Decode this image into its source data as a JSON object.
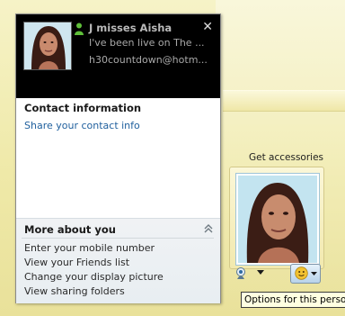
{
  "contact_card": {
    "name": "J misses Aisha",
    "message": "I've been live on The ...",
    "email": "h30countdown@hotm...",
    "status_color": "#5fbf3a",
    "contact_info": {
      "title": "Contact information",
      "share_link": "Share your contact info"
    },
    "more_about": {
      "title": "More about you",
      "items": [
        "Enter your mobile number",
        "View your Friends list",
        "Change your display picture",
        "View sharing folders"
      ]
    }
  },
  "accessories": {
    "label": "Get accessories",
    "options_tooltip": "Options for this person"
  },
  "icons": {
    "status": "person-online-icon",
    "close": "close-icon",
    "collapse": "double-chevron-up-icon",
    "webcam": "webcam-icon",
    "options": "emoticon-icon"
  }
}
